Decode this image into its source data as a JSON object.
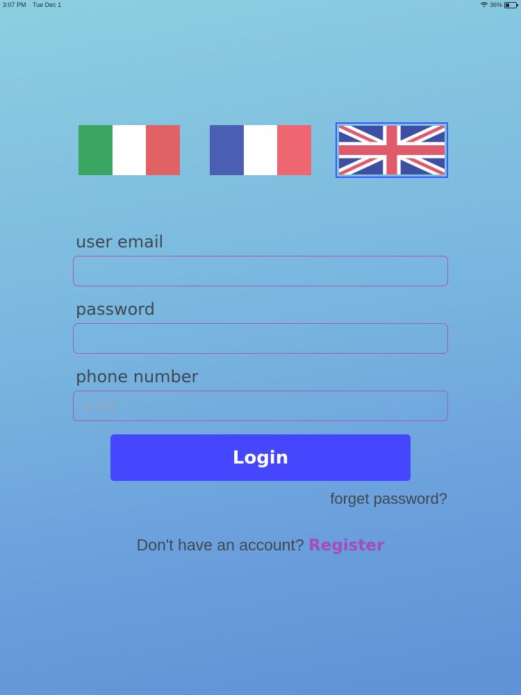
{
  "status_bar": {
    "time": "3:07 PM",
    "date": "Tue Dec 1",
    "battery": "36%",
    "battery_level": 0.36
  },
  "languages": [
    {
      "name": "Italian",
      "colors": [
        "#3aa661",
        "#ffffff",
        "#e06264"
      ]
    },
    {
      "name": "French",
      "colors": [
        "#4a5fb2",
        "#ffffff",
        "#ee6670"
      ]
    },
    {
      "name": "English",
      "selected": true
    }
  ],
  "form": {
    "email_label": "user email",
    "email_value": "",
    "password_label": "password",
    "password_value": "",
    "phone_label": "phone number",
    "phone_placeholder": "+44"
  },
  "actions": {
    "login_label": "Login",
    "forget_label": "forget password?",
    "register_prompt": "Don't have an account?",
    "register_label": "Register"
  },
  "colors": {
    "accent": "#4646ff",
    "link": "#a54bc0",
    "selected_border": "#3a57ff"
  }
}
